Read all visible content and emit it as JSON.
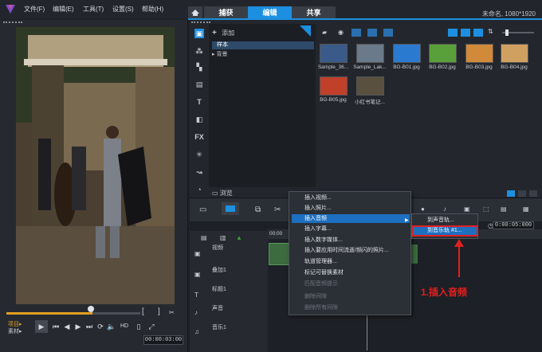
{
  "menu": {
    "items": [
      "文件(F)",
      "编辑(E)",
      "工具(T)",
      "设置(S)",
      "帮助(H)"
    ]
  },
  "window_title": "未命名, 1080*1920",
  "top_tabs": [
    "捕获",
    "编辑",
    "共享"
  ],
  "preview": {
    "mode_project": "项目▸",
    "mode_clip": "素材▸",
    "timecode": "00:00:03:00",
    "hd_label": "HD"
  },
  "library": {
    "add_label": "添加",
    "folders": [
      "样本",
      "背景"
    ],
    "browse_label": "浏览",
    "thumbnails": [
      {
        "label": "Sample_36...",
        "color": "#3a5a8a"
      },
      {
        "label": "Sample_Lak...",
        "color": "#6a7a8a"
      },
      {
        "label": "BG-B01.jpg",
        "color": "#2a7ad0"
      },
      {
        "label": "BG-B02.jpg",
        "color": "#5aa03a"
      },
      {
        "label": "BG-B03.jpg",
        "color": "#d08a3a"
      },
      {
        "label": "BG-B04.jpg",
        "color": "#d0a060"
      },
      {
        "label": "BG-B05.jpg",
        "color": "#c0402a"
      },
      {
        "label": "小红书笔记...",
        "color": "#5a5040"
      }
    ]
  },
  "timeline": {
    "ruler_start": "00:00",
    "timecode": "0:00:05:000",
    "tracks": [
      {
        "name": "视频"
      },
      {
        "name": "叠加1"
      },
      {
        "name": "标题1"
      },
      {
        "name": "声音"
      },
      {
        "name": "音乐1"
      }
    ]
  },
  "context_menu": {
    "items": [
      {
        "label": "插入视频...",
        "state": "normal"
      },
      {
        "label": "插入照片...",
        "state": "normal"
      },
      {
        "label": "插入音频",
        "state": "highlight"
      },
      {
        "label": "插入字幕...",
        "state": "normal"
      },
      {
        "label": "插入数字媒体...",
        "state": "normal"
      },
      {
        "label": "插入要应用时间流逝/频闪的照片...",
        "state": "normal"
      },
      {
        "label": "轨道管理器...",
        "state": "normal"
      },
      {
        "label": "标记可替换素材",
        "state": "normal"
      },
      {
        "label": "匹配音频提示",
        "state": "disabled"
      },
      {
        "label": "删除间隙",
        "state": "disabled"
      },
      {
        "label": "删除所有间隙",
        "state": "disabled"
      }
    ],
    "submenu": [
      "到声音轨...",
      "到音乐轨 #1..."
    ]
  },
  "annotation": "1.插入音频",
  "colors": {
    "accent": "#1d8fe0",
    "highlight": "#1d6fc0",
    "annotation_red": "#e02020"
  }
}
